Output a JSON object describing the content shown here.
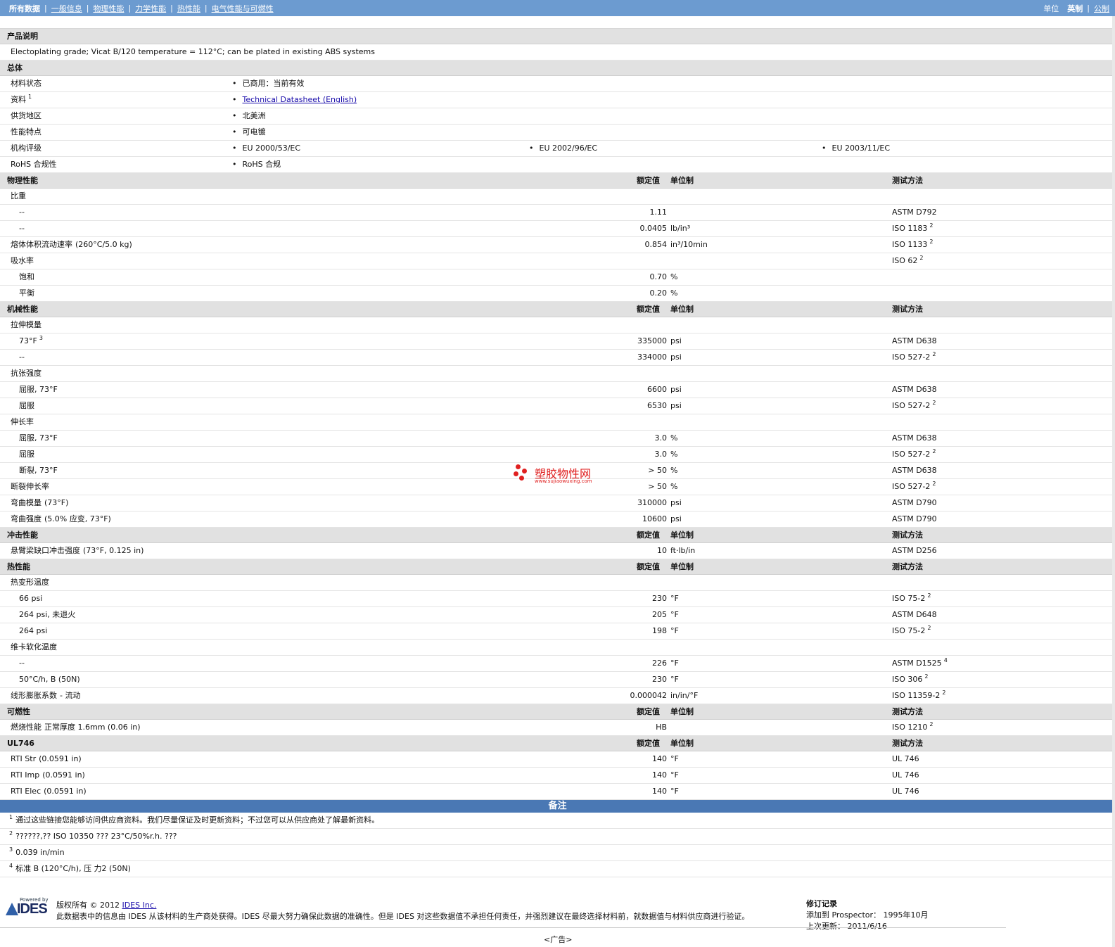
{
  "nav": {
    "items": [
      "所有数据",
      "一般信息",
      "物理性能",
      "力学性能",
      "热性能",
      "电气性能与可燃性"
    ],
    "units_label": "单位",
    "units": [
      "英制",
      "公制"
    ]
  },
  "headers": {
    "value": "额定值",
    "unit": "单位制",
    "method": "测试方法"
  },
  "description": {
    "title": "产品说明",
    "text": "Electoplating grade; Vicat B/120 temperature = 112°C; can be plated in existing ABS systems"
  },
  "general": {
    "title": "总体",
    "rows": [
      {
        "label": "材料状态",
        "sup": "",
        "values": [
          "已商用：当前有效"
        ]
      },
      {
        "label": "资料",
        "sup": "1",
        "values": [
          "Technical Datasheet (English)"
        ],
        "link": true
      },
      {
        "label": "供货地区",
        "sup": "",
        "values": [
          "北美洲"
        ]
      },
      {
        "label": "性能特点",
        "sup": "",
        "values": [
          "可电镀"
        ]
      },
      {
        "label": "机构评级",
        "sup": "",
        "values": [
          "EU 2000/53/EC",
          "EU 2002/96/EC",
          "EU 2003/11/EC"
        ]
      },
      {
        "label": "RoHS 合规性",
        "sup": "",
        "values": [
          "RoHS 合规"
        ]
      }
    ]
  },
  "sections": [
    {
      "title": "物理性能",
      "headers": true,
      "rows": [
        {
          "label": "比重",
          "cond": "",
          "indent": 0,
          "value": "",
          "unit": "",
          "method": "",
          "sup": ""
        },
        {
          "label": "--",
          "cond": "",
          "indent": 1,
          "value": "1.11",
          "unit": "",
          "method": "ASTM D792",
          "sup": ""
        },
        {
          "label": "--",
          "cond": "",
          "indent": 1,
          "value": "0.0405",
          "unit": "lb/in³",
          "method": "ISO 1183",
          "sup": "2"
        },
        {
          "label": "熔体体积流动速率",
          "cond": "(260°C/5.0 kg)",
          "indent": 0,
          "value": "0.854",
          "unit": "in³/10min",
          "method": "ISO 1133",
          "sup": "2"
        },
        {
          "label": "吸水率",
          "cond": "",
          "indent": 0,
          "value": "",
          "unit": "",
          "method": "ISO 62",
          "sup": "2"
        },
        {
          "label": "饱和",
          "cond": "",
          "indent": 1,
          "value": "0.70",
          "unit": "%",
          "method": "",
          "sup": ""
        },
        {
          "label": "平衡",
          "cond": "",
          "indent": 1,
          "value": "0.20",
          "unit": "%",
          "method": "",
          "sup": ""
        }
      ]
    },
    {
      "title": "机械性能",
      "headers": true,
      "rows": [
        {
          "label": "拉伸模量",
          "cond": "",
          "indent": 0,
          "value": "",
          "unit": "",
          "method": "",
          "sup": ""
        },
        {
          "label": "73°F",
          "labelsup": "3",
          "cond": "",
          "indent": 1,
          "value": "335000",
          "unit": "psi",
          "method": "ASTM D638",
          "sup": ""
        },
        {
          "label": "--",
          "cond": "",
          "indent": 1,
          "value": "334000",
          "unit": "psi",
          "method": "ISO 527-2",
          "sup": "2"
        },
        {
          "label": "抗张强度",
          "cond": "",
          "indent": 0,
          "value": "",
          "unit": "",
          "method": "",
          "sup": ""
        },
        {
          "label": "屈服, 73°F",
          "cond": "",
          "indent": 1,
          "value": "6600",
          "unit": "psi",
          "method": "ASTM D638",
          "sup": ""
        },
        {
          "label": "屈服",
          "cond": "",
          "indent": 1,
          "value": "6530",
          "unit": "psi",
          "method": "ISO 527-2",
          "sup": "2"
        },
        {
          "label": "伸长率",
          "cond": "",
          "indent": 0,
          "value": "",
          "unit": "",
          "method": "",
          "sup": ""
        },
        {
          "label": "屈服, 73°F",
          "cond": "",
          "indent": 1,
          "value": "3.0",
          "unit": "%",
          "method": "ASTM D638",
          "sup": ""
        },
        {
          "label": "屈服",
          "cond": "",
          "indent": 1,
          "value": "3.0",
          "unit": "%",
          "method": "ISO 527-2",
          "sup": "2"
        },
        {
          "label": "断裂, 73°F",
          "cond": "",
          "indent": 1,
          "value": "> 50",
          "unit": "%",
          "method": "ASTM D638",
          "sup": ""
        },
        {
          "label": "断裂伸长率",
          "cond": "",
          "indent": 0,
          "value": "> 50",
          "unit": "%",
          "method": "ISO 527-2",
          "sup": "2"
        },
        {
          "label": "弯曲模量",
          "cond": "(73°F)",
          "indent": 0,
          "value": "310000",
          "unit": "psi",
          "method": "ASTM D790",
          "sup": ""
        },
        {
          "label": "弯曲强度",
          "cond": "(5.0% 应变, 73°F)",
          "indent": 0,
          "value": "10600",
          "unit": "psi",
          "method": "ASTM D790",
          "sup": ""
        }
      ]
    },
    {
      "title": "冲击性能",
      "headers": true,
      "rows": [
        {
          "label": "悬臂梁缺口冲击强度",
          "cond": "(73°F, 0.125 in)",
          "indent": 0,
          "value": "10",
          "unit": "ft·lb/in",
          "method": "ASTM D256",
          "sup": ""
        }
      ]
    },
    {
      "title": "热性能",
      "headers": true,
      "rows": [
        {
          "label": "热变形温度",
          "cond": "",
          "indent": 0,
          "value": "",
          "unit": "",
          "method": "",
          "sup": ""
        },
        {
          "label": "66 psi",
          "cond": "",
          "indent": 1,
          "value": "230",
          "unit": "°F",
          "method": "ISO 75-2",
          "sup": "2"
        },
        {
          "label": "264 psi, 未退火",
          "cond": "",
          "indent": 1,
          "value": "205",
          "unit": "°F",
          "method": "ASTM D648",
          "sup": ""
        },
        {
          "label": "264 psi",
          "cond": "",
          "indent": 1,
          "value": "198",
          "unit": "°F",
          "method": "ISO 75-2",
          "sup": "2"
        },
        {
          "label": "维卡软化温度",
          "cond": "",
          "indent": 0,
          "value": "",
          "unit": "",
          "method": "",
          "sup": ""
        },
        {
          "label": "--",
          "cond": "",
          "indent": 1,
          "value": "226",
          "unit": "°F",
          "method": "ASTM D1525",
          "sup": "4"
        },
        {
          "label": "50°C/h, B (50N)",
          "cond": "",
          "indent": 1,
          "value": "230",
          "unit": "°F",
          "method": "ISO 306",
          "sup": "2"
        },
        {
          "label": "线形膨胀系数",
          "cond": "- 流动",
          "indent": 0,
          "value": "0.000042",
          "unit": "in/in/°F",
          "method": "ISO 11359-2",
          "sup": "2"
        }
      ]
    },
    {
      "title": "可燃性",
      "headers": true,
      "rows": [
        {
          "label": "燃烧性能",
          "cond": "正常厚度   1.6mm (0.06 in)",
          "indent": 0,
          "value": "HB",
          "unit": "",
          "method": "ISO 1210",
          "sup": "2"
        }
      ]
    },
    {
      "title": "UL746",
      "headers": true,
      "rows": [
        {
          "label": "RTI Str",
          "cond": "(0.0591 in)",
          "indent": 0,
          "value": "140",
          "unit": "°F",
          "method": "UL 746",
          "sup": ""
        },
        {
          "label": "RTI Imp",
          "cond": "(0.0591 in)",
          "indent": 0,
          "value": "140",
          "unit": "°F",
          "method": "UL 746",
          "sup": ""
        },
        {
          "label": "RTI Elec",
          "cond": "(0.0591 in)",
          "indent": 0,
          "value": "140",
          "unit": "°F",
          "method": "UL 746",
          "sup": ""
        }
      ]
    }
  ],
  "notes": {
    "title": "备注",
    "items": [
      {
        "num": "1",
        "text": "通过这些链接您能够访问供应商资料。我们尽量保证及时更新资料；不过您可以从供应商处了解最新资料。"
      },
      {
        "num": "2",
        "text": "??????,?? ISO 10350 ??? 23°C/50%r.h. ???"
      },
      {
        "num": "3",
        "text": "0.039 in/min"
      },
      {
        "num": "4",
        "text": "标准 B (120°C/h), 压 力2 (50N)"
      }
    ]
  },
  "footer": {
    "logo_powered": "Powered by",
    "logo_text": "IDES",
    "copyright_prefix": "版权所有  © 2012",
    "copyright_link": "IDES Inc.",
    "disclaimer": "此数据表中的信息由 IDES 从该材料的生产商处获得。IDES 尽最大努力确保此数据的准确性。但是 IDES 对这些数据值不承担任何责任，并强烈建议在最终选择材料前，就数据值与材料供应商进行验证。",
    "revision_title": "修订记录",
    "added_label": "添加到 Prospector：",
    "added_value": "1995年10月",
    "updated_label": "上次更新：",
    "updated_value": "2011/6/16",
    "ad": "<广告>"
  },
  "watermark": {
    "name": "塑胶物性网",
    "url": "www.sujiaowuxing.com",
    "color": "#e02020"
  }
}
